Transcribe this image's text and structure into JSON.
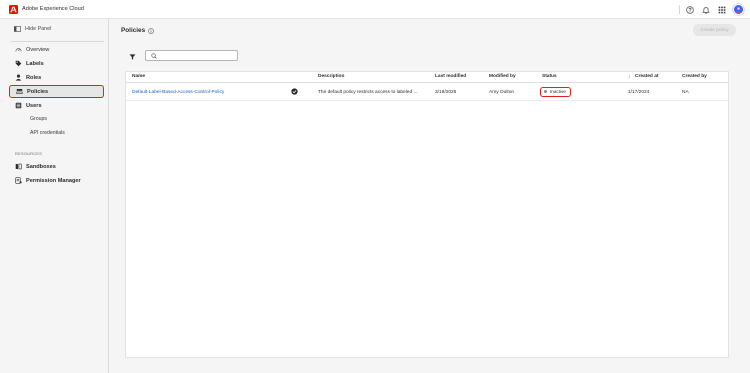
{
  "header": {
    "app_name": "Adobe Experience Cloud",
    "icons": [
      "help-icon",
      "bell-icon",
      "apps-grid-icon",
      "user-avatar"
    ]
  },
  "sidebar": {
    "hide_panel_label": "Hide Panel",
    "items": [
      {
        "label": "Overview",
        "icon": "overview-icon"
      },
      {
        "label": "Labels",
        "icon": "tag-icon"
      },
      {
        "label": "Roles",
        "icon": "person-icon"
      },
      {
        "label": "Policies",
        "icon": "policy-icon",
        "active": true
      },
      {
        "label": "Users",
        "icon": "users-icon"
      }
    ],
    "subitems": [
      {
        "label": "Groups"
      },
      {
        "label": "API credentials"
      }
    ],
    "resources_heading": "RESOURCES",
    "resources": [
      {
        "label": "Sandboxes",
        "icon": "sandbox-icon"
      },
      {
        "label": "Permission Manager",
        "icon": "permission-manager-icon"
      }
    ]
  },
  "main": {
    "title": "Policies",
    "create_button": "Create policy",
    "search": {
      "placeholder": "",
      "value": ""
    },
    "table": {
      "columns": [
        "Name",
        "Description",
        "Last modified",
        "Modified by",
        "Status",
        "Created at",
        "Created by"
      ],
      "sorted_column": "Created at",
      "sort_direction": "descending",
      "rows": [
        {
          "name": "Default-Label-Based-Access-Control-Policy",
          "description": "The default policy restricts access to labeled ...",
          "last_modified": "3/19/2025",
          "modified_by": "Amy Oulton",
          "status": "Inactive",
          "created_at": "1/17/2024",
          "created_by": "NA"
        }
      ]
    }
  },
  "colors": {
    "brand_red": "#eb1000",
    "link_blue": "#1b5fc1",
    "highlight_red": "#e02020",
    "avatar_blue": "#3b63fb"
  }
}
